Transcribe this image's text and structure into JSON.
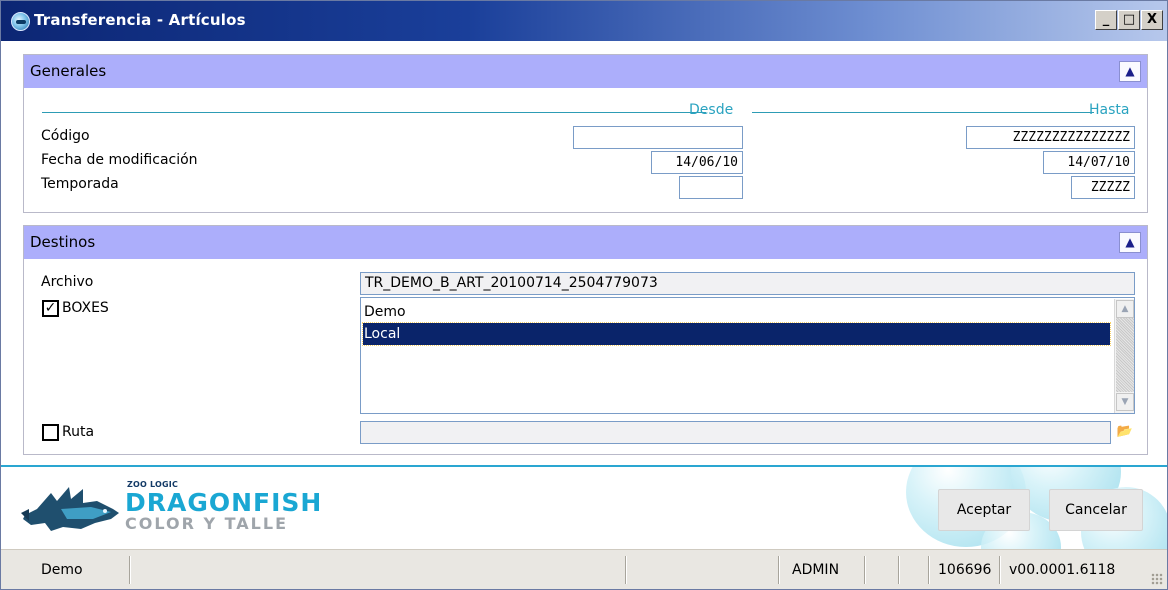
{
  "window": {
    "title": "Transferencia - Artículos",
    "controls": {
      "minimize": "_",
      "maximize": "□",
      "close": "X"
    }
  },
  "generales": {
    "title": "Generales",
    "collapse_icon": "double-chevron-up-icon",
    "col_from": "Desde",
    "col_to": "Hasta",
    "fields": [
      {
        "label": "Código",
        "from": "",
        "to": "ZZZZZZZZZZZZZZZ"
      },
      {
        "label": "Fecha de modificación",
        "from": "14/06/10",
        "to": "14/07/10"
      },
      {
        "label": "Temporada",
        "from": "",
        "to": "ZZZZZ"
      }
    ]
  },
  "destinos": {
    "title": "Destinos",
    "collapse_icon": "double-chevron-up-icon",
    "archivo_label": "Archivo",
    "archivo_value": "TR_DEMO_B_ART_20100714_2504779073",
    "boxes_label": "BOXES",
    "boxes_checked": true,
    "boxes_list": [
      "Demo",
      "Local"
    ],
    "boxes_selected": "Local",
    "ruta_label": "Ruta",
    "ruta_checked": false,
    "ruta_value": ""
  },
  "footer": {
    "logo_small": "ZOO LOGIC",
    "logo_main": "DRAGONFISH",
    "logo_sub": "COLOR Y TALLE",
    "accept_label": "Aceptar",
    "cancel_label": "Cancelar"
  },
  "statusbar": {
    "database": "Demo",
    "user": "ADMIN",
    "number": "106696",
    "version": "v00.0001.6118"
  },
  "colors": {
    "section_header": "#acaefb",
    "accent": "#2aa3c0",
    "selection": "#0a246a"
  }
}
